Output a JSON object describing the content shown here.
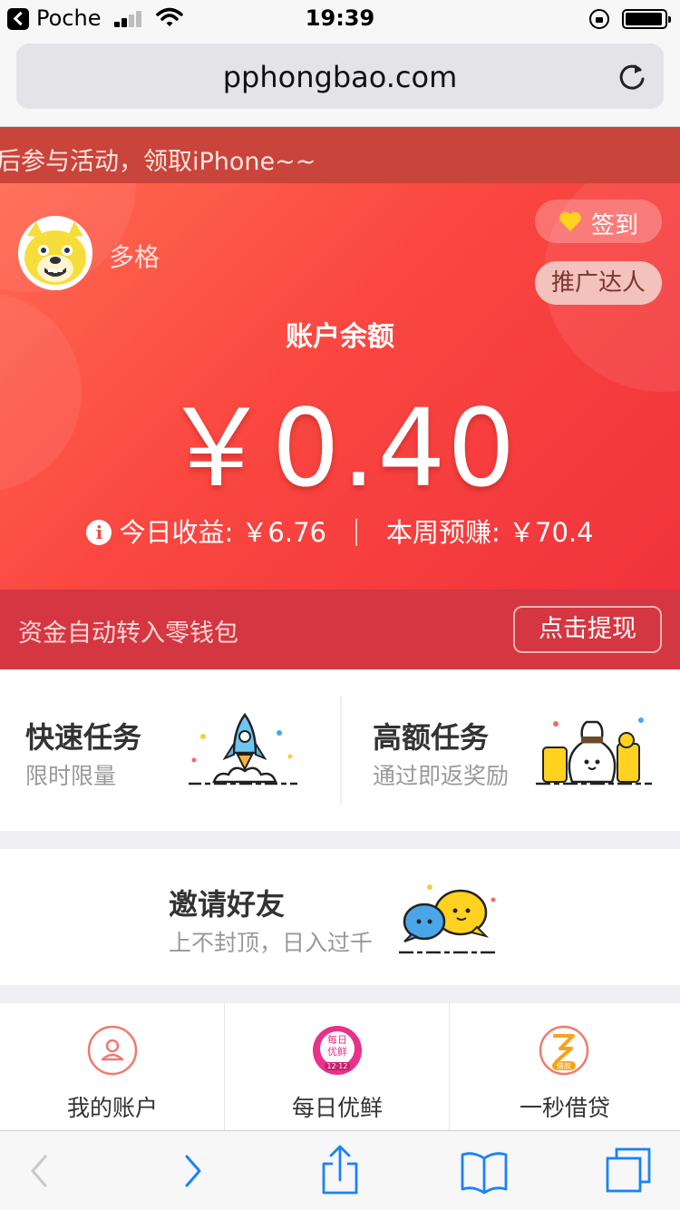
{
  "status_bar": {
    "carrier": "Poche",
    "time": "19:39"
  },
  "browser": {
    "url": "pphongbao.com"
  },
  "marquee": {
    "text": "后参与活动，领取iPhone~~"
  },
  "account": {
    "username": "多格",
    "signin_label": "签到",
    "promo_label": "推广达人",
    "balance_label": "账户余额",
    "balance_value": "￥0.40",
    "today_earnings": "今日收益: ￥6.76",
    "week_earnings": "本周预赚: ￥70.4",
    "transfer_note": "资金自动转入零钱包",
    "withdraw_label": "点击提现"
  },
  "tasks": [
    {
      "title": "快速任务",
      "subtitle": "限时限量",
      "icon": "rocket-icon"
    },
    {
      "title": "高额任务",
      "subtitle": "通过即返奖励",
      "icon": "money-bag-icon"
    }
  ],
  "invite": {
    "title": "邀请好友",
    "subtitle": "上不封顶，日入过千",
    "icon": "chat-bubbles-icon"
  },
  "shortcuts": [
    {
      "label": "我的账户",
      "icon": "user-icon"
    },
    {
      "label": "每日优鲜",
      "icon": "daily-fresh-icon",
      "badge_top": "每日",
      "badge_bottom": "优鲜",
      "badge_tag": "12·12"
    },
    {
      "label": "一秒借贷",
      "icon": "loan-icon",
      "badge_tag": "借款"
    }
  ],
  "colors": {
    "accent_red": "#f04a40",
    "dark_red": "#d43642",
    "ios_blue": "#1a82fb"
  }
}
